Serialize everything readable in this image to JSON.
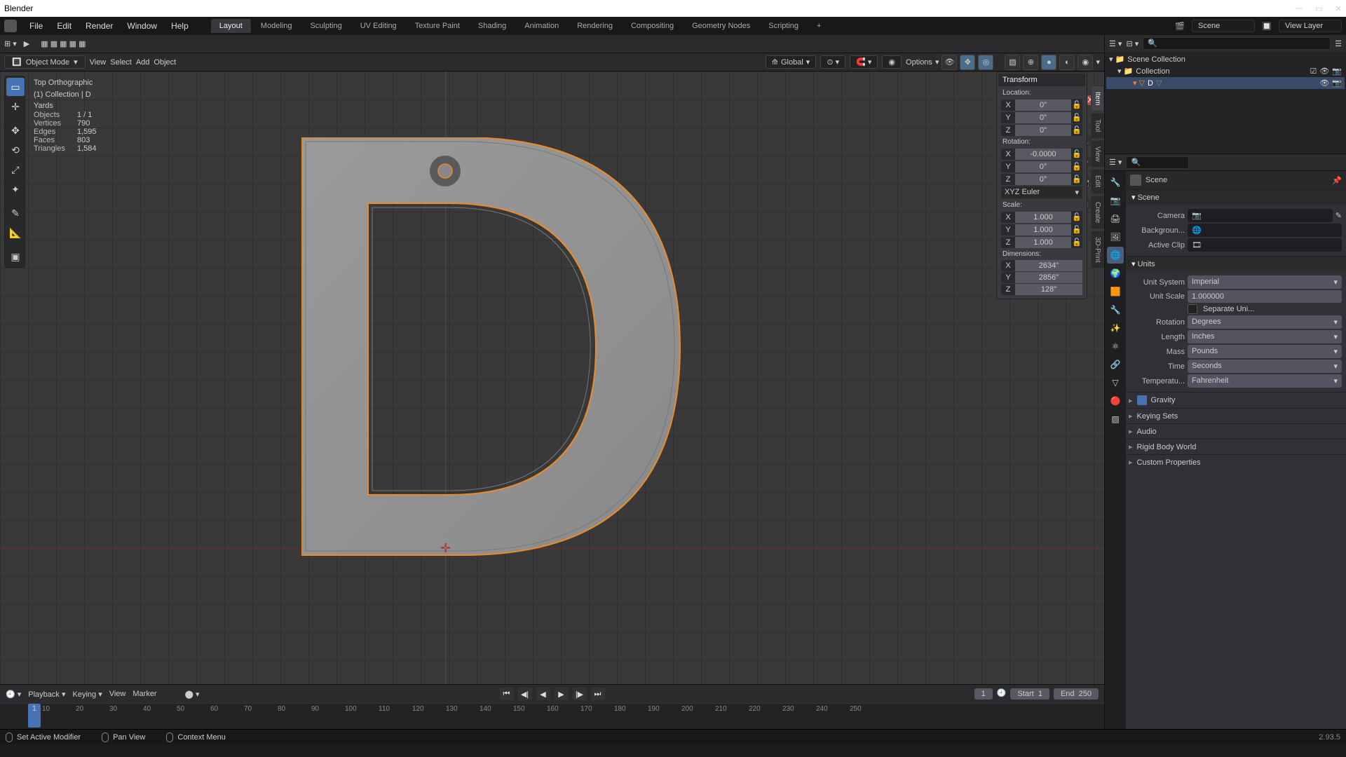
{
  "app": {
    "title": "Blender",
    "version": "2.93.5"
  },
  "menus": [
    "File",
    "Edit",
    "Render",
    "Window",
    "Help"
  ],
  "workspaces": [
    "Layout",
    "Modeling",
    "Sculpting",
    "UV Editing",
    "Texture Paint",
    "Shading",
    "Animation",
    "Rendering",
    "Compositing",
    "Geometry Nodes",
    "Scripting"
  ],
  "scene_name": "Scene",
  "view_layer": "View Layer",
  "header3d": {
    "mode": "Object Mode",
    "view": "View",
    "select": "Select",
    "add": "Add",
    "object": "Object",
    "orientation": "Global",
    "options": "Options"
  },
  "overlay": {
    "viewname": "Top Orthographic",
    "collection": "(1) Collection | D",
    "units": "Yards"
  },
  "stats": {
    "objects": "1 / 1",
    "vertices": "790",
    "edges": "1,595",
    "faces": "803",
    "triangles": "1,584"
  },
  "side_tabs": [
    "Item",
    "Tool",
    "View",
    "Edit",
    "Create",
    "3D-Print"
  ],
  "npanel": {
    "title": "Transform",
    "location": "Location:",
    "rotation": "Rotation:",
    "scale": "Scale:",
    "dimensions": "Dimensions:",
    "loc": {
      "x": "0\"",
      "y": "0\"",
      "z": "0\""
    },
    "rot": {
      "x": "-0.0000",
      "y": "0°",
      "z": "0°",
      "mode": "XYZ Euler"
    },
    "scl": {
      "x": "1.000",
      "y": "1.000",
      "z": "1.000"
    },
    "dim": {
      "x": "2634\"",
      "y": "2856\"",
      "z": "128\""
    }
  },
  "outliner": {
    "root": "Scene Collection",
    "coll": "Collection",
    "obj": "D"
  },
  "props": {
    "crumb": "Scene",
    "panel_scene": "Scene",
    "camera": "Camera",
    "background": "Backgroun...",
    "active_clip": "Active Clip",
    "units": "Units",
    "unit_system": "Unit System",
    "unit_system_val": "Imperial",
    "unit_scale": "Unit Scale",
    "unit_scale_val": "1.000000",
    "separate": "Separate Uni...",
    "rotation": "Rotation",
    "rotation_val": "Degrees",
    "length": "Length",
    "length_val": "Inches",
    "mass": "Mass",
    "mass_val": "Pounds",
    "time": "Time",
    "time_val": "Seconds",
    "temp": "Temperatu...",
    "temp_val": "Fahrenheit",
    "gravity": "Gravity",
    "keying": "Keying Sets",
    "audio": "Audio",
    "rigid": "Rigid Body World",
    "custom": "Custom Properties"
  },
  "timeline": {
    "playback": "Playback",
    "keying": "Keying",
    "view": "View",
    "marker": "Marker",
    "frame": "1",
    "start": "Start",
    "start_v": "1",
    "end": "End",
    "end_v": "250",
    "ticks": [
      10,
      20,
      30,
      40,
      50,
      60,
      70,
      80,
      90,
      100,
      110,
      120,
      130,
      140,
      150,
      160,
      170,
      180,
      190,
      200,
      210,
      220,
      230,
      240,
      250
    ]
  },
  "status": {
    "action": "Set Active Modifier",
    "pan": "Pan View",
    "ctx": "Context Menu"
  }
}
